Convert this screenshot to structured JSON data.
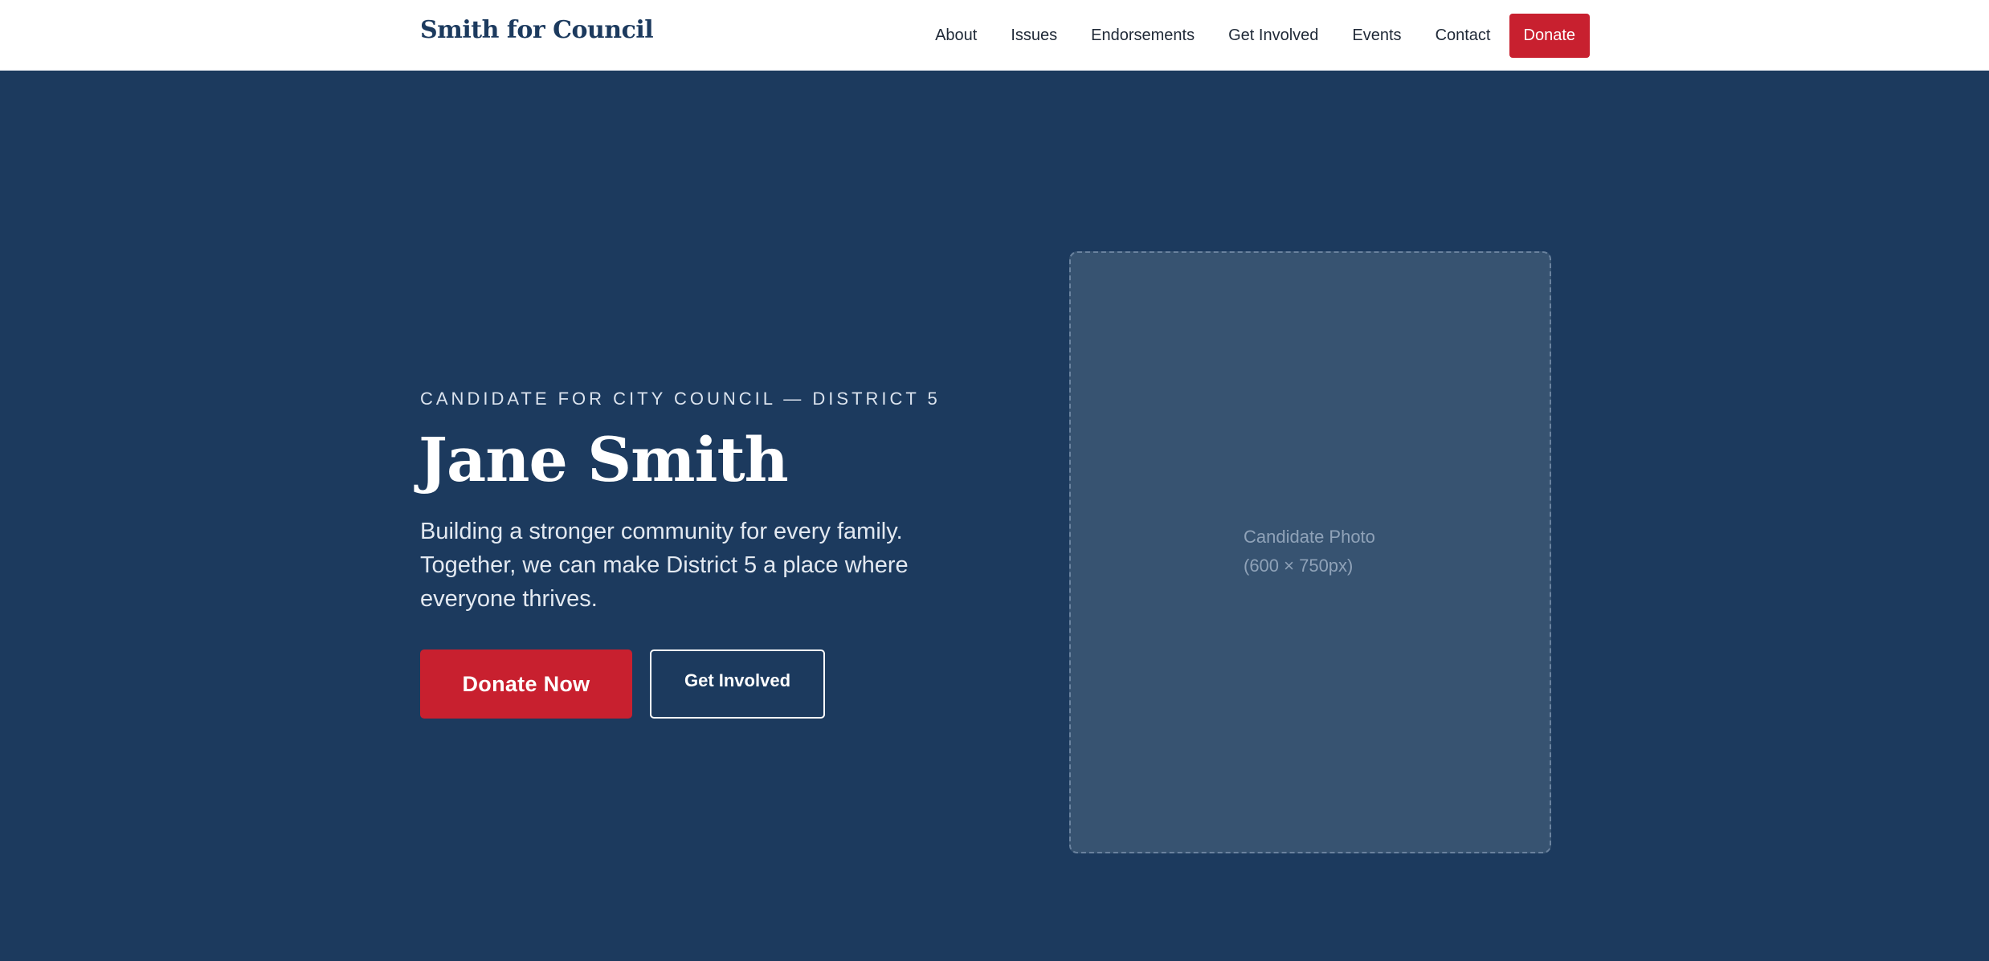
{
  "header": {
    "brand": "Smith for Council",
    "nav": [
      {
        "label": "About"
      },
      {
        "label": "Issues"
      },
      {
        "label": "Endorsements"
      },
      {
        "label": "Get Involved"
      },
      {
        "label": "Events"
      },
      {
        "label": "Contact"
      }
    ],
    "donate_label": "Donate"
  },
  "hero": {
    "eyebrow": "Candidate for City Council — District 5",
    "name": "Jane Smith",
    "tagline": "Building a stronger community for every family. Together, we can make District 5 a place where everyone thrives.",
    "primary_cta": "Donate Now",
    "secondary_cta": "Get Involved",
    "photo_caption_line1": "Candidate Photo",
    "photo_caption_line2": "(600 × 750px)"
  },
  "colors": {
    "navy": "#1c3a5e",
    "accent_red": "#c8202f",
    "white": "#ffffff",
    "photo_placeholder": "#375371"
  }
}
